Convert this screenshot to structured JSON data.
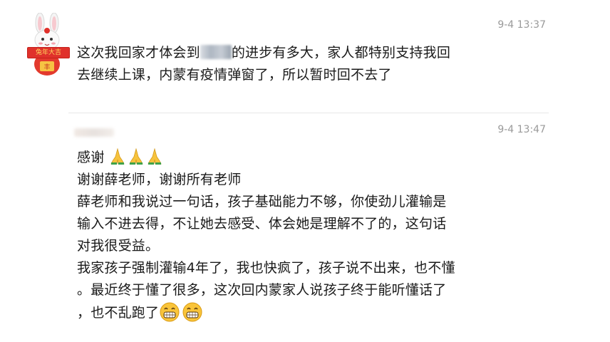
{
  "messages": [
    {
      "time": "9-4 13:37",
      "lines": [
        {
          "before": "这次我回家才体会到",
          "after": "的进步有多大，家人都特别支持我回"
        },
        {
          "text": "去继续上课，内蒙有疫情弹窗了，所以暂时回不去了"
        }
      ]
    },
    {
      "time": "9-4 13:47",
      "lines": [
        "感谢",
        "谢谢薛老师，谢谢所有老师",
        "薛老师和我说过一句话，孩子基础能力不够，你使劲儿灌输是",
        "输入不进去得，不让她去感受、体会她是理解不了的，这句话",
        "对我很受益。",
        "我家孩子强制灌输4年了，我也快疯了，孩子说不出来，也不懂",
        "。最近终于懂了很多，这次回内蒙家人说孩子终于能听懂话了",
        "，也不乱跑了"
      ]
    }
  ],
  "avatar_banner_text": "兔年大吉",
  "colors": {
    "time": "#9a9a9a",
    "text": "#1a1a1a",
    "divider": "#e8e8e8"
  },
  "icons": [
    "rabbit-avatar-icon",
    "pray-hands-emoji",
    "grinning-face-emoji"
  ]
}
